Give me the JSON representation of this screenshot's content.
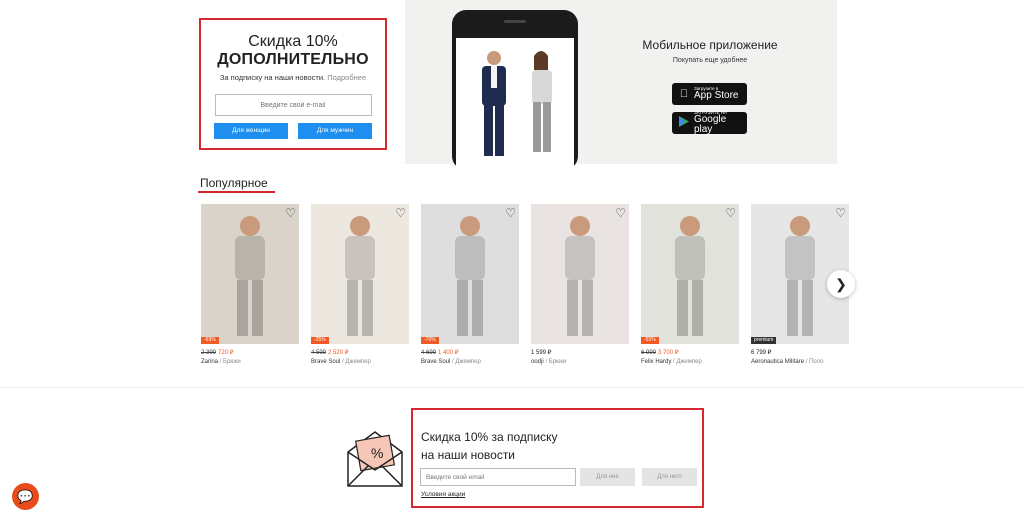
{
  "promo": {
    "title_line1": "Скидка 10%",
    "title_line2": "ДОПОЛНИТЕЛЬНО",
    "subtitle": "За подписку на наши новости.",
    "more_link": "Подробнее",
    "email_placeholder": "Введите свой e-mail",
    "btn_women": "Для женщин",
    "btn_men": "Для мужчин"
  },
  "app_banner": {
    "title": "Мобильное приложение",
    "subtitle": "Покупать еще удобнее",
    "appstore_small": "Загрузите в",
    "appstore_big": "App Store",
    "googleplay_small": "ЗАГРУЗИТЕ НА",
    "googleplay_big": "Google play"
  },
  "popular": {
    "title": "Популярное",
    "products": [
      {
        "badge": "-69%",
        "badge_color": "#f15a24",
        "old_price": "2 399",
        "new_price": "720 ₽",
        "brand": "Zarina",
        "category": "Брюки",
        "img_color": "#d9d3c9"
      },
      {
        "badge": "-35%",
        "badge_color": "#f15a24",
        "old_price": "4 599",
        "new_price": "2 520 ₽",
        "brand": "Brave Soul",
        "category": "Джемпер",
        "img_color": "#ece7df"
      },
      {
        "badge": "-70%",
        "badge_color": "#f15a24",
        "old_price": "4 699",
        "new_price": "1 400 ₽",
        "brand": "Brave Soul",
        "category": "Джемпер",
        "img_color": "#dedede"
      },
      {
        "badge": "",
        "badge_color": "",
        "old_price": "",
        "new_price": "",
        "regular_price": "1 599 ₽",
        "brand": "oodji",
        "category": "Брюки",
        "img_color": "#e9e4e2"
      },
      {
        "badge": "-55%",
        "badge_color": "#f15a24",
        "old_price": "6 999",
        "new_price": "3 700 ₽",
        "brand": "Felix Hardy",
        "category": "Джемпер",
        "img_color": "#e2e2dc"
      },
      {
        "badge": "premium",
        "badge_color": "#333333",
        "old_price": "",
        "new_price": "",
        "regular_price": "6 799 ₽",
        "brand": "Aeronautica Militare",
        "category": "Поло",
        "img_color": "#e6e6e6"
      }
    ]
  },
  "subscribe": {
    "title_line1": "Скидка 10% за подписку",
    "title_line2": "на наши новости",
    "email_placeholder": "Введите свой email",
    "btn_her": "Для нее",
    "btn_him": "Для него",
    "terms": "Условия акции"
  },
  "icons": {
    "heart": "heart-icon",
    "next": "chevron-right-icon",
    "chat": "chat-icon",
    "apple": "apple-icon",
    "play": "google-play-icon"
  }
}
